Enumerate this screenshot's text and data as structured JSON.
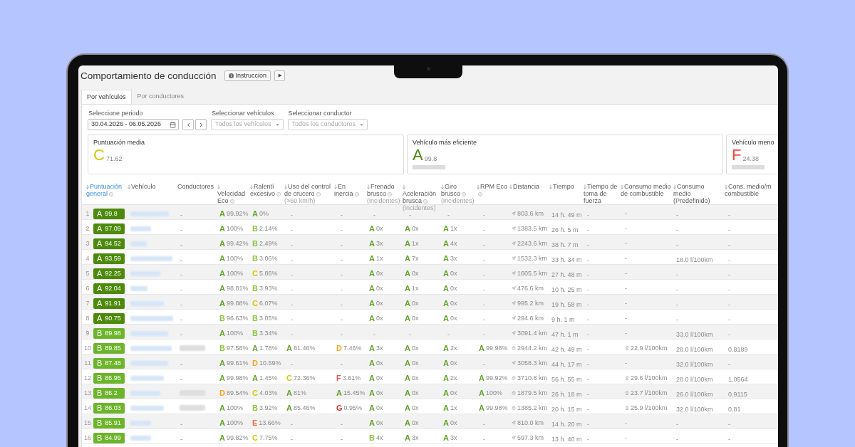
{
  "page": {
    "title": "Comportamiento de conducción",
    "buttons": [
      {
        "kind": "info",
        "label": "Instruccion"
      },
      {
        "kind": "play"
      }
    ]
  },
  "tabs": [
    {
      "label": "Por vehículos",
      "selected": true
    },
    {
      "label": "Por conductores",
      "selected": false
    }
  ],
  "filters": [
    {
      "kind": "date",
      "label": "Seleccione periodo",
      "value": "30.04.2026 - 06.05.2026"
    },
    {
      "kind": "select",
      "label": "Seleccionar vehículos",
      "placeholder": "Todos los vehículos"
    },
    {
      "kind": "select",
      "label": "Seleccionar conductor",
      "placeholder": "Todos los conductores"
    }
  ],
  "summary_cards": [
    {
      "label": "Puntuación media",
      "grade": "C",
      "value": "71.62",
      "color": "#d2cb00",
      "blurred_name": false
    },
    {
      "label": "Vehículo más eficiente",
      "grade": "A",
      "value": "99.8",
      "color": "#4c8a0b",
      "blurred_name": true
    },
    {
      "label": "Vehículo meno",
      "grade": "F",
      "value": "24.38",
      "color": "#ef4640",
      "blurred_name": true
    }
  ],
  "table": {
    "columns": [
      {
        "label": "Puntuación general",
        "sortable": true,
        "sorted": true,
        "info": true
      },
      {
        "label": "Vehículo",
        "sortable": true,
        "sorted": false,
        "info": false
      },
      {
        "label": "Conductores",
        "sortable": false,
        "sorted": false,
        "info": false
      },
      {
        "label": "Velocidad Eco",
        "sortable": true,
        "sorted": false,
        "info": true
      },
      {
        "label": "Ralentí excesivo",
        "sortable": true,
        "sorted": false,
        "info": true
      },
      {
        "label": "Uso del control de crucero",
        "sortable": true,
        "sorted": false,
        "info": true,
        "note": "(>60 km/h)"
      },
      {
        "label": "En inercia",
        "sortable": true,
        "sorted": false,
        "info": true
      },
      {
        "label": "Frenado brusco",
        "sortable": true,
        "sorted": false,
        "info": true,
        "note": "(incidentes)"
      },
      {
        "label": "Aceleración brusca",
        "sortable": true,
        "sorted": false,
        "info": true,
        "note": "(incidentes)"
      },
      {
        "label": "Giro brusco",
        "sortable": true,
        "sorted": false,
        "info": true,
        "note": "(incidentes)"
      },
      {
        "label": "RPM Eco",
        "sortable": true,
        "sorted": false,
        "info": true
      },
      {
        "label": "Distancia",
        "sortable": true,
        "sorted": false,
        "info": false
      },
      {
        "label": "Tiempo",
        "sortable": true,
        "sorted": false,
        "info": false
      },
      {
        "label": "Tiempo de toma de fuerza",
        "sortable": true,
        "sorted": false,
        "info": false
      },
      {
        "label": "Consumo medio de combustible",
        "sortable": true,
        "sorted": false,
        "info": false
      },
      {
        "label": "Consumo medio (Predefinido)",
        "sortable": true,
        "sorted": false,
        "info": false
      },
      {
        "label": "Cons. medio/m combustible",
        "sortable": true,
        "sorted": false,
        "info": false
      }
    ],
    "rows": [
      {
        "number": "1",
        "score": {
          "grade": "A",
          "value": "99.8",
          "color": "#4c8a0b"
        },
        "driver": {
          "kind": "text",
          "text": "-"
        },
        "metrics": [
          {
            "kind": "grade",
            "grade": "A",
            "value": "99.92%",
            "color": "#62a52b"
          },
          {
            "kind": "grade",
            "grade": "A",
            "value": "0%",
            "color": "#62a52b"
          },
          {
            "kind": "empty",
            "text": "-"
          },
          {
            "kind": "empty",
            "text": "-"
          },
          {
            "kind": "empty",
            "text": "-"
          },
          {
            "kind": "empty",
            "text": "-"
          },
          {
            "kind": "empty",
            "text": "-"
          },
          {
            "kind": "empty",
            "text": "-"
          }
        ],
        "distance": {
          "kind": "arrow",
          "text": "803.6 km"
        },
        "time": "14 h. 49 m",
        "pto": "-",
        "fuel_avg": {
          "kind": "plain",
          "text": "-"
        },
        "fuel_default": "-",
        "fuel_ratio": "-"
      },
      {
        "number": "2",
        "score": {
          "grade": "A",
          "value": "97.09",
          "color": "#4c8a0b"
        },
        "driver": {
          "kind": "text",
          "text": "-"
        },
        "metrics": [
          {
            "kind": "grade",
            "grade": "A",
            "value": "100%",
            "color": "#62a52b"
          },
          {
            "kind": "grade",
            "grade": "B",
            "value": "2.14%",
            "color": "#8dc63f"
          },
          {
            "kind": "empty",
            "text": "-"
          },
          {
            "kind": "empty",
            "text": "-"
          },
          {
            "kind": "grade",
            "grade": "A",
            "value": "0x",
            "color": "#62a52b"
          },
          {
            "kind": "grade",
            "grade": "A",
            "value": "0x",
            "color": "#62a52b"
          },
          {
            "kind": "grade",
            "grade": "A",
            "value": "1x",
            "color": "#62a52b"
          },
          {
            "kind": "empty",
            "text": "-"
          }
        ],
        "distance": {
          "kind": "arrow",
          "text": "1383.5 km"
        },
        "time": "26 h. 5 m",
        "pto": "-",
        "fuel_avg": {
          "kind": "plain",
          "text": "-"
        },
        "fuel_default": "-",
        "fuel_ratio": "-"
      },
      {
        "number": "3",
        "score": {
          "grade": "A",
          "value": "94.52",
          "color": "#4c8a0b"
        },
        "driver": {
          "kind": "text",
          "text": "-"
        },
        "metrics": [
          {
            "kind": "grade",
            "grade": "A",
            "value": "99.42%",
            "color": "#62a52b"
          },
          {
            "kind": "grade",
            "grade": "B",
            "value": "2.49%",
            "color": "#8dc63f"
          },
          {
            "kind": "empty",
            "text": "-"
          },
          {
            "kind": "empty",
            "text": "-"
          },
          {
            "kind": "grade",
            "grade": "A",
            "value": "3x",
            "color": "#62a52b"
          },
          {
            "kind": "grade",
            "grade": "A",
            "value": "1x",
            "color": "#62a52b"
          },
          {
            "kind": "grade",
            "grade": "A",
            "value": "4x",
            "color": "#62a52b"
          },
          {
            "kind": "empty",
            "text": "-"
          }
        ],
        "distance": {
          "kind": "arrow",
          "text": "2243.6 km"
        },
        "time": "38 h. 7 m",
        "pto": "-",
        "fuel_avg": {
          "kind": "plain",
          "text": "-"
        },
        "fuel_default": "-",
        "fuel_ratio": "-"
      },
      {
        "number": "4",
        "score": {
          "grade": "A",
          "value": "93.59",
          "color": "#4c8a0b"
        },
        "driver": {
          "kind": "text",
          "text": "-"
        },
        "metrics": [
          {
            "kind": "grade",
            "grade": "A",
            "value": "100%",
            "color": "#62a52b"
          },
          {
            "kind": "grade",
            "grade": "B",
            "value": "3.06%",
            "color": "#8dc63f"
          },
          {
            "kind": "empty",
            "text": "-"
          },
          {
            "kind": "empty",
            "text": "-"
          },
          {
            "kind": "grade",
            "grade": "A",
            "value": "1x",
            "color": "#62a52b"
          },
          {
            "kind": "grade",
            "grade": "A",
            "value": "7x",
            "color": "#62a52b"
          },
          {
            "kind": "grade",
            "grade": "A",
            "value": "3x",
            "color": "#62a52b"
          },
          {
            "kind": "empty",
            "text": "-"
          }
        ],
        "distance": {
          "kind": "arrow",
          "text": "1532.3 km"
        },
        "time": "33 h. 34 m",
        "pto": "-",
        "fuel_avg": {
          "kind": "plain",
          "text": "-"
        },
        "fuel_default": "18.0 l/100km",
        "fuel_ratio": "-"
      },
      {
        "number": "5",
        "score": {
          "grade": "A",
          "value": "92.25",
          "color": "#4c8a0b"
        },
        "driver": {
          "kind": "text",
          "text": "-"
        },
        "metrics": [
          {
            "kind": "grade",
            "grade": "A",
            "value": "100%",
            "color": "#62a52b"
          },
          {
            "kind": "grade",
            "grade": "C",
            "value": "5.86%",
            "color": "#d2cb00"
          },
          {
            "kind": "empty",
            "text": "-"
          },
          {
            "kind": "empty",
            "text": "-"
          },
          {
            "kind": "grade",
            "grade": "A",
            "value": "0x",
            "color": "#62a52b"
          },
          {
            "kind": "grade",
            "grade": "A",
            "value": "0x",
            "color": "#62a52b"
          },
          {
            "kind": "grade",
            "grade": "A",
            "value": "0x",
            "color": "#62a52b"
          },
          {
            "kind": "empty",
            "text": "-"
          }
        ],
        "distance": {
          "kind": "arrow",
          "text": "1605.5 km"
        },
        "time": "27 h. 48 m",
        "pto": "-",
        "fuel_avg": {
          "kind": "plain",
          "text": "-"
        },
        "fuel_default": "-",
        "fuel_ratio": "-"
      },
      {
        "number": "6",
        "score": {
          "grade": "A",
          "value": "92.04",
          "color": "#4c8a0b"
        },
        "driver": {
          "kind": "text",
          "text": "-"
        },
        "metrics": [
          {
            "kind": "grade",
            "grade": "A",
            "value": "98.81%",
            "color": "#62a52b"
          },
          {
            "kind": "grade",
            "grade": "B",
            "value": "3.93%",
            "color": "#8dc63f"
          },
          {
            "kind": "empty",
            "text": "-"
          },
          {
            "kind": "empty",
            "text": "-"
          },
          {
            "kind": "grade",
            "grade": "A",
            "value": "0x",
            "color": "#62a52b"
          },
          {
            "kind": "grade",
            "grade": "A",
            "value": "1x",
            "color": "#62a52b"
          },
          {
            "kind": "grade",
            "grade": "A",
            "value": "0x",
            "color": "#62a52b"
          },
          {
            "kind": "empty",
            "text": "-"
          }
        ],
        "distance": {
          "kind": "arrow",
          "text": "476.6 km"
        },
        "time": "10 h. 25 m",
        "pto": "-",
        "fuel_avg": {
          "kind": "plain",
          "text": "-"
        },
        "fuel_default": "-",
        "fuel_ratio": "-"
      },
      {
        "number": "7",
        "score": {
          "grade": "A",
          "value": "91.91",
          "color": "#4c8a0b"
        },
        "driver": {
          "kind": "text",
          "text": "-"
        },
        "metrics": [
          {
            "kind": "grade",
            "grade": "A",
            "value": "99.88%",
            "color": "#62a52b"
          },
          {
            "kind": "grade",
            "grade": "C",
            "value": "6.07%",
            "color": "#d2cb00"
          },
          {
            "kind": "empty",
            "text": "-"
          },
          {
            "kind": "empty",
            "text": "-"
          },
          {
            "kind": "grade",
            "grade": "A",
            "value": "0x",
            "color": "#62a52b"
          },
          {
            "kind": "grade",
            "grade": "A",
            "value": "0x",
            "color": "#62a52b"
          },
          {
            "kind": "grade",
            "grade": "A",
            "value": "0x",
            "color": "#62a52b"
          },
          {
            "kind": "empty",
            "text": "-"
          }
        ],
        "distance": {
          "kind": "arrow",
          "text": "995.2 km"
        },
        "time": "19 h. 58 m",
        "pto": "-",
        "fuel_avg": {
          "kind": "plain",
          "text": "-"
        },
        "fuel_default": "-",
        "fuel_ratio": "-"
      },
      {
        "number": "8",
        "score": {
          "grade": "A",
          "value": "90.75",
          "color": "#4c8a0b"
        },
        "driver": {
          "kind": "text",
          "text": "-"
        },
        "metrics": [
          {
            "kind": "grade",
            "grade": "B",
            "value": "96.63%",
            "color": "#8dc63f"
          },
          {
            "kind": "grade",
            "grade": "B",
            "value": "3.05%",
            "color": "#8dc63f"
          },
          {
            "kind": "empty",
            "text": "-"
          },
          {
            "kind": "empty",
            "text": "-"
          },
          {
            "kind": "grade",
            "grade": "A",
            "value": "0x",
            "color": "#62a52b"
          },
          {
            "kind": "grade",
            "grade": "A",
            "value": "0x",
            "color": "#62a52b"
          },
          {
            "kind": "grade",
            "grade": "A",
            "value": "0x",
            "color": "#62a52b"
          },
          {
            "kind": "empty",
            "text": "-"
          }
        ],
        "distance": {
          "kind": "arrow",
          "text": "294.6 km"
        },
        "time": "9 h. 1 m",
        "pto": "-",
        "fuel_avg": {
          "kind": "plain",
          "text": "-"
        },
        "fuel_default": "-",
        "fuel_ratio": "-"
      },
      {
        "number": "9",
        "score": {
          "grade": "B",
          "value": "89.98",
          "color": "#6cb52b"
        },
        "driver": {
          "kind": "text",
          "text": "-"
        },
        "metrics": [
          {
            "kind": "grade",
            "grade": "A",
            "value": "100%",
            "color": "#62a52b"
          },
          {
            "kind": "grade",
            "grade": "B",
            "value": "3.34%",
            "color": "#8dc63f"
          },
          {
            "kind": "empty",
            "text": "-"
          },
          {
            "kind": "empty",
            "text": "-"
          },
          {
            "kind": "empty",
            "text": "-"
          },
          {
            "kind": "empty",
            "text": "-"
          },
          {
            "kind": "empty",
            "text": "-"
          },
          {
            "kind": "empty",
            "text": "-"
          }
        ],
        "distance": {
          "kind": "arrow",
          "text": "3091.4 km"
        },
        "time": "47 h. 1 m",
        "pto": "-",
        "fuel_avg": {
          "kind": "plain",
          "text": "-"
        },
        "fuel_default": "33.0 l/100km",
        "fuel_ratio": "-"
      },
      {
        "number": "10",
        "score": {
          "grade": "B",
          "value": "89.85",
          "color": "#6cb52b"
        },
        "driver": {
          "kind": "blurred"
        },
        "metrics": [
          {
            "kind": "grade",
            "grade": "B",
            "value": "97.58%",
            "color": "#8dc63f"
          },
          {
            "kind": "grade",
            "grade": "A",
            "value": "1.78%",
            "color": "#62a52b"
          },
          {
            "kind": "grade",
            "grade": "A",
            "value": "81.46%",
            "color": "#62a52b"
          },
          {
            "kind": "grade",
            "grade": "D",
            "value": "7.46%",
            "color": "#f5a524"
          },
          {
            "kind": "grade",
            "grade": "A",
            "value": "3x",
            "color": "#62a52b"
          },
          {
            "kind": "grade",
            "grade": "A",
            "value": "0x",
            "color": "#62a52b"
          },
          {
            "kind": "grade",
            "grade": "A",
            "value": "2x",
            "color": "#62a52b"
          },
          {
            "kind": "grade",
            "grade": "A",
            "value": "99.98%",
            "color": "#62a52b"
          }
        ],
        "distance": {
          "kind": "dial",
          "text": "2944.2 km"
        },
        "time": "42 h. 49 m",
        "pto": "-",
        "fuel_avg": {
          "kind": "pin",
          "text": "22.9 l/100km"
        },
        "fuel_default": "28.0 l/100km",
        "fuel_ratio": "0.8189"
      },
      {
        "number": "11",
        "score": {
          "grade": "B",
          "value": "87.48",
          "color": "#6cb52b"
        },
        "driver": {
          "kind": "text",
          "text": "-"
        },
        "metrics": [
          {
            "kind": "grade",
            "grade": "A",
            "value": "99.61%",
            "color": "#62a52b"
          },
          {
            "kind": "grade",
            "grade": "D",
            "value": "10.59%",
            "color": "#f5a524"
          },
          {
            "kind": "empty",
            "text": "-"
          },
          {
            "kind": "empty",
            "text": "-"
          },
          {
            "kind": "grade",
            "grade": "A",
            "value": "0x",
            "color": "#62a52b"
          },
          {
            "kind": "grade",
            "grade": "A",
            "value": "0x",
            "color": "#62a52b"
          },
          {
            "kind": "grade",
            "grade": "A",
            "value": "0x",
            "color": "#62a52b"
          },
          {
            "kind": "empty",
            "text": "-"
          }
        ],
        "distance": {
          "kind": "arrow",
          "text": "3058.3 km"
        },
        "time": "44 h. 17 m",
        "pto": "-",
        "fuel_avg": {
          "kind": "plain",
          "text": "-"
        },
        "fuel_default": "32.0 l/100km",
        "fuel_ratio": "-"
      },
      {
        "number": "12",
        "score": {
          "grade": "B",
          "value": "86.95",
          "color": "#6cb52b"
        },
        "driver": {
          "kind": "text",
          "text": "-"
        },
        "metrics": [
          {
            "kind": "grade",
            "grade": "A",
            "value": "99.98%",
            "color": "#62a52b"
          },
          {
            "kind": "grade",
            "grade": "A",
            "value": "1.45%",
            "color": "#62a52b"
          },
          {
            "kind": "grade",
            "grade": "C",
            "value": "72.36%",
            "color": "#d2cb00"
          },
          {
            "kind": "grade",
            "grade": "F",
            "value": "3.61%",
            "color": "#ef4f4f"
          },
          {
            "kind": "grade",
            "grade": "A",
            "value": "0x",
            "color": "#62a52b"
          },
          {
            "kind": "grade",
            "grade": "A",
            "value": "0x",
            "color": "#62a52b"
          },
          {
            "kind": "grade",
            "grade": "A",
            "value": "2x",
            "color": "#62a52b"
          },
          {
            "kind": "grade",
            "grade": "A",
            "value": "99.92%",
            "color": "#62a52b"
          }
        ],
        "distance": {
          "kind": "dial",
          "text": "3710.8 km"
        },
        "time": "56 h. 55 m",
        "pto": "-",
        "fuel_avg": {
          "kind": "pin",
          "text": "29.6 l/100km"
        },
        "fuel_default": "28.0 l/100km",
        "fuel_ratio": "1.0564"
      },
      {
        "number": "13",
        "score": {
          "grade": "B",
          "value": "86.2",
          "color": "#6cb52b"
        },
        "driver": {
          "kind": "blurred"
        },
        "metrics": [
          {
            "kind": "grade",
            "grade": "D",
            "value": "89.54%",
            "color": "#f5a524"
          },
          {
            "kind": "grade",
            "grade": "C",
            "value": "4.03%",
            "color": "#d2cb00"
          },
          {
            "kind": "grade",
            "grade": "A",
            "value": "81%",
            "color": "#62a52b"
          },
          {
            "kind": "grade",
            "grade": "A",
            "value": "15.45%",
            "color": "#62a52b"
          },
          {
            "kind": "grade",
            "grade": "A",
            "value": "0x",
            "color": "#62a52b"
          },
          {
            "kind": "grade",
            "grade": "A",
            "value": "0x",
            "color": "#62a52b"
          },
          {
            "kind": "grade",
            "grade": "A",
            "value": "0x",
            "color": "#62a52b"
          },
          {
            "kind": "grade",
            "grade": "A",
            "value": "100%",
            "color": "#62a52b"
          }
        ],
        "distance": {
          "kind": "dial",
          "text": "1879.5 km"
        },
        "time": "26 h. 18 m",
        "pto": "-",
        "fuel_avg": {
          "kind": "pin",
          "text": "23.7 l/100km"
        },
        "fuel_default": "26.0 l/100km",
        "fuel_ratio": "0.9115"
      },
      {
        "number": "14",
        "score": {
          "grade": "B",
          "value": "86.03",
          "color": "#6cb52b"
        },
        "driver": {
          "kind": "blurred"
        },
        "metrics": [
          {
            "kind": "grade",
            "grade": "A",
            "value": "100%",
            "color": "#62a52b"
          },
          {
            "kind": "grade",
            "grade": "B",
            "value": "3.92%",
            "color": "#8dc63f"
          },
          {
            "kind": "grade",
            "grade": "A",
            "value": "85.46%",
            "color": "#62a52b"
          },
          {
            "kind": "grade",
            "grade": "G",
            "value": "0.95%",
            "color": "#e3302f"
          },
          {
            "kind": "grade",
            "grade": "A",
            "value": "0x",
            "color": "#62a52b"
          },
          {
            "kind": "grade",
            "grade": "A",
            "value": "0x",
            "color": "#62a52b"
          },
          {
            "kind": "grade",
            "grade": "A",
            "value": "1x",
            "color": "#62a52b"
          },
          {
            "kind": "grade",
            "grade": "A",
            "value": "99.98%",
            "color": "#62a52b"
          }
        ],
        "distance": {
          "kind": "dial",
          "text": "1385.2 km"
        },
        "time": "20 h. 15 m",
        "pto": "-",
        "fuel_avg": {
          "kind": "pin",
          "text": "25.9 l/100km"
        },
        "fuel_default": "32.0 l/100km",
        "fuel_ratio": "0.81"
      },
      {
        "number": "15",
        "score": {
          "grade": "B",
          "value": "85.91",
          "color": "#6cb52b"
        },
        "driver": {
          "kind": "text",
          "text": "-"
        },
        "metrics": [
          {
            "kind": "grade",
            "grade": "A",
            "value": "100%",
            "color": "#62a52b"
          },
          {
            "kind": "grade",
            "grade": "E",
            "value": "13.66%",
            "color": "#f26d3d"
          },
          {
            "kind": "empty",
            "text": "-"
          },
          {
            "kind": "empty",
            "text": "-"
          },
          {
            "kind": "grade",
            "grade": "A",
            "value": "0x",
            "color": "#62a52b"
          },
          {
            "kind": "grade",
            "grade": "A",
            "value": "0x",
            "color": "#62a52b"
          },
          {
            "kind": "grade",
            "grade": "A",
            "value": "0x",
            "color": "#62a52b"
          },
          {
            "kind": "empty",
            "text": "-"
          }
        ],
        "distance": {
          "kind": "arrow",
          "text": "810.0 km"
        },
        "time": "14 h. 20 m",
        "pto": "-",
        "fuel_avg": {
          "kind": "plain",
          "text": "-"
        },
        "fuel_default": "-",
        "fuel_ratio": "-"
      },
      {
        "number": "16",
        "score": {
          "grade": "B",
          "value": "84.99",
          "color": "#6cb52b"
        },
        "driver": {
          "kind": "text",
          "text": "-"
        },
        "metrics": [
          {
            "kind": "grade",
            "grade": "A",
            "value": "99.82%",
            "color": "#62a52b"
          },
          {
            "kind": "grade",
            "grade": "C",
            "value": "7.75%",
            "color": "#d2cb00"
          },
          {
            "kind": "empty",
            "text": "-"
          },
          {
            "kind": "empty",
            "text": "-"
          },
          {
            "kind": "grade",
            "grade": "B",
            "value": "4x",
            "color": "#8dc63f"
          },
          {
            "kind": "grade",
            "grade": "A",
            "value": "3x",
            "color": "#62a52b"
          },
          {
            "kind": "grade",
            "grade": "A",
            "value": "3x",
            "color": "#62a52b"
          },
          {
            "kind": "empty",
            "text": "-"
          }
        ],
        "distance": {
          "kind": "arrow",
          "text": "597.3 km"
        },
        "time": "13 h. 40 m",
        "pto": "-",
        "fuel_avg": {
          "kind": "plain",
          "text": "-"
        },
        "fuel_default": "-",
        "fuel_ratio": "-"
      }
    ]
  }
}
